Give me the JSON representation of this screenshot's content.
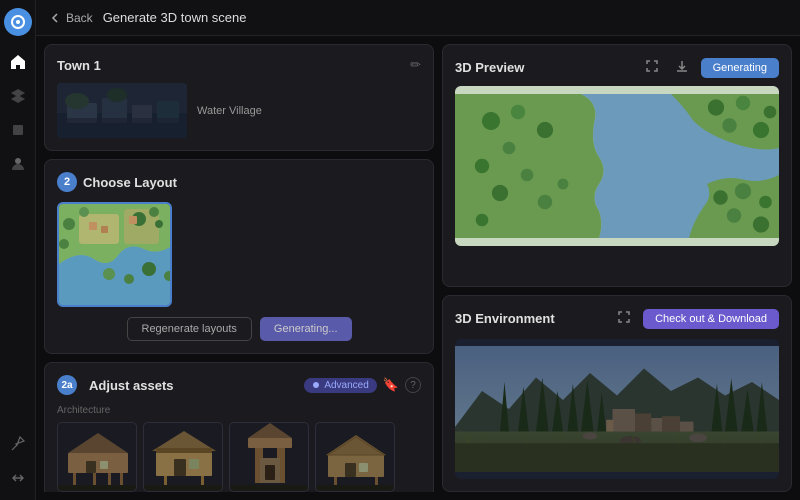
{
  "app": {
    "logo_color": "#4a90e2"
  },
  "topbar": {
    "back_label": "Back",
    "title": "Generate 3D town scene"
  },
  "sidebar": {
    "icons": [
      "🏠",
      "📦",
      "🔧",
      "👤"
    ],
    "bottom_icons": [
      "📐",
      "↔"
    ]
  },
  "town_card": {
    "title": "Town 1",
    "label": "Water Village",
    "edit_icon": "✏️"
  },
  "layout_card": {
    "step": "2",
    "title": "Choose Layout",
    "regenerate_btn": "Regenerate layouts",
    "generating_btn": "Generating..."
  },
  "assets_card": {
    "step": "2a",
    "title": "Adjust assets",
    "advanced_label": "Advanced",
    "section_label": "Architecture",
    "icon_bookmark": "🔖",
    "icon_question": "?"
  },
  "preview_card": {
    "title": "3D Preview",
    "generating_btn": "Generating"
  },
  "env_card": {
    "title": "3D Environment",
    "checkout_btn": "Check out & Download"
  }
}
